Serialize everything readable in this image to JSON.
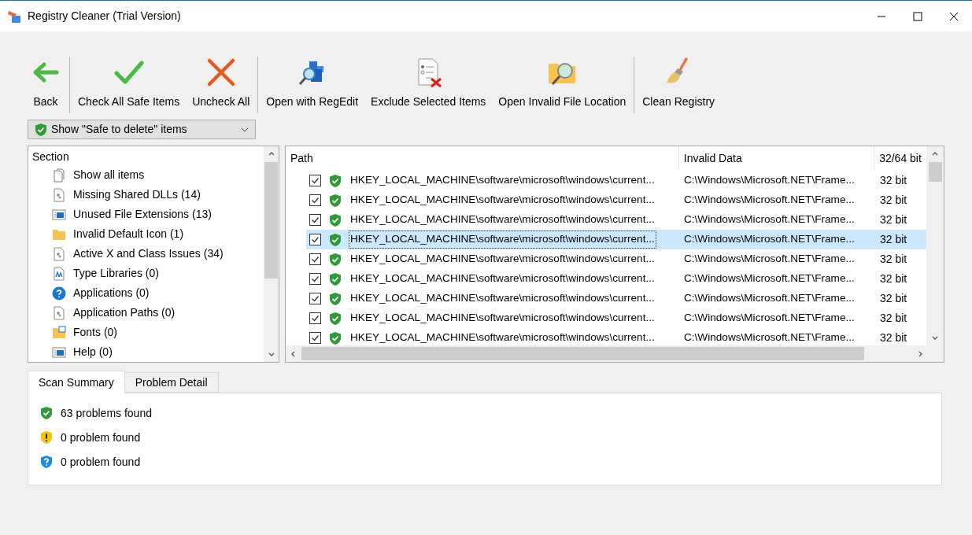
{
  "window": {
    "title": "Registry Cleaner (Trial Version)"
  },
  "toolbar": {
    "groups": [
      [
        {
          "label": "Back",
          "kind": "back"
        }
      ],
      [
        {
          "label": "Check All Safe Items",
          "kind": "check"
        },
        {
          "label": "Uncheck All",
          "kind": "cross"
        }
      ],
      [
        {
          "label": "Open with RegEdit",
          "kind": "regedit"
        },
        {
          "label": "Exclude Selected Items",
          "kind": "exclude"
        },
        {
          "label": "Open Invalid File Location",
          "kind": "folder-search"
        }
      ],
      [
        {
          "label": "Clean Registry",
          "kind": "broom"
        }
      ]
    ]
  },
  "filter": {
    "value": "Show \"Safe to delete\" items"
  },
  "sections": {
    "header": "Section",
    "items": [
      {
        "label": "Show all items",
        "kind": "pages"
      },
      {
        "label": "Missing Shared DLLs (14)",
        "kind": "dll"
      },
      {
        "label": "Unused File Extensions (13)",
        "kind": "window"
      },
      {
        "label": "Invalid Default Icon (1)",
        "kind": "folder"
      },
      {
        "label": "Active X and Class Issues (34)",
        "kind": "dll"
      },
      {
        "label": "Type Libraries (0)",
        "kind": "typelib"
      },
      {
        "label": "Applications (0)",
        "kind": "question"
      },
      {
        "label": "Application Paths (0)",
        "kind": "dll"
      },
      {
        "label": "Fonts (0)",
        "kind": "fonts"
      },
      {
        "label": "Help (0)",
        "kind": "window"
      }
    ]
  },
  "table": {
    "columns": [
      "Path",
      "Invalid Data",
      "32/64 bit"
    ],
    "rows": [
      {
        "checked": true,
        "selected": false,
        "path": "HKEY_LOCAL_MACHINE\\software\\microsoft\\windows\\current...",
        "data": "C:\\Windows\\Microsoft.NET\\Frame...",
        "bits": "32 bit"
      },
      {
        "checked": true,
        "selected": false,
        "path": "HKEY_LOCAL_MACHINE\\software\\microsoft\\windows\\current...",
        "data": "C:\\Windows\\Microsoft.NET\\Frame...",
        "bits": "32 bit"
      },
      {
        "checked": true,
        "selected": false,
        "path": "HKEY_LOCAL_MACHINE\\software\\microsoft\\windows\\current...",
        "data": "C:\\Windows\\Microsoft.NET\\Frame...",
        "bits": "32 bit"
      },
      {
        "checked": true,
        "selected": true,
        "path": "HKEY_LOCAL_MACHINE\\software\\microsoft\\windows\\current...",
        "data": "C:\\Windows\\Microsoft.NET\\Frame...",
        "bits": "32 bit"
      },
      {
        "checked": true,
        "selected": false,
        "path": "HKEY_LOCAL_MACHINE\\software\\microsoft\\windows\\current...",
        "data": "C:\\Windows\\Microsoft.NET\\Frame...",
        "bits": "32 bit"
      },
      {
        "checked": true,
        "selected": false,
        "path": "HKEY_LOCAL_MACHINE\\software\\microsoft\\windows\\current...",
        "data": "C:\\Windows\\Microsoft.NET\\Frame...",
        "bits": "32 bit"
      },
      {
        "checked": true,
        "selected": false,
        "path": "HKEY_LOCAL_MACHINE\\software\\microsoft\\windows\\current...",
        "data": "C:\\Windows\\Microsoft.NET\\Frame...",
        "bits": "32 bit"
      },
      {
        "checked": true,
        "selected": false,
        "path": "HKEY_LOCAL_MACHINE\\software\\microsoft\\windows\\current...",
        "data": "C:\\Windows\\Microsoft.NET\\Frame...",
        "bits": "32 bit"
      },
      {
        "checked": true,
        "selected": false,
        "path": "HKEY_LOCAL_MACHINE\\software\\microsoft\\windows\\current...",
        "data": "C:\\Windows\\Microsoft.NET\\Frame...",
        "bits": "32 bit"
      }
    ]
  },
  "tabs": [
    {
      "label": "Scan Summary",
      "selected": true
    },
    {
      "label": "Problem Detail",
      "selected": false
    }
  ],
  "summary": [
    {
      "kind": "safe",
      "text": "63 problems found"
    },
    {
      "kind": "warning",
      "text": "0 problem found"
    },
    {
      "kind": "info",
      "text": "0 problem found"
    }
  ]
}
